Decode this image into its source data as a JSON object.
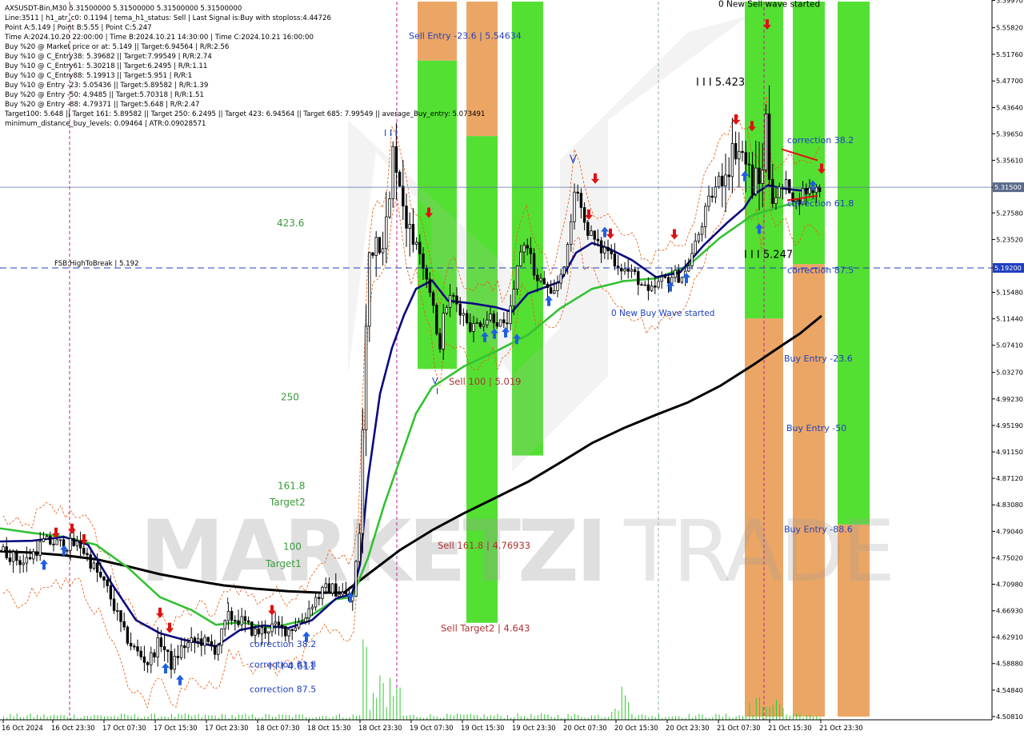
{
  "window": {
    "title_line": "AXSUSDT-Bin,M30  5.31500000 5.31500000 5.31500000 5.31500000"
  },
  "info_lines": [
    "Line:3511 | h1_atr_c0: 0.1194 | tema_h1_status: Sell | Last Signal is:Buy with stoploss:4.44726",
    "Point A:5.149 | Point B:5.55 | Point C:5.247",
    "Time A:2024.10.20 22:00:00 | Time B:2024.10.21 14:30:00 | Time C:2024.10.21 16:00:00",
    "Buy %20 @ Market price or at: 5.149 || Target:6.94564 | R/R:2.56",
    "Buy %10 @ C_Entry38: 5.39682 || Target:7.99549 | R/R:2.74",
    "Buy %10 @ C_Entry61: 5.30218 || Target:6.2495 | R/R:1.11",
    "Buy %10 @ C_Entry88: 5.19913 || Target:5.951 | R/R:1",
    "Buy %10 @ Entry -23: 5.05436 || Target:5.89582 | R/R:1.39",
    "Buy %20 @ Entry -50: 4.9485 || Target:5.70318 | R/R:1.51",
    "Buy %20 @ Entry -88: 4.79371 || Target:5.648 | R/R:2.47",
    "Target100: 5.648 || Target 161: 5.89582 || Target 250: 6.2495 || Target 423: 6.94564 || Target 685: 7.99549 || average_Buy_entry: 5.073491",
    "minimum_distance_buy_levels: 0.09464 | ATR:0.09028571"
  ],
  "watermark": {
    "left": "MARKETZI",
    "right": "TRADE"
  },
  "chart_data": {
    "type": "candlestick",
    "symbol": "AXSUSDT-Bin",
    "timeframe": "M30",
    "ylim": [
      4.508,
      5.598
    ],
    "current_price": 5.315,
    "y_ticks": [
      "5.59970",
      "5.55820",
      "5.51760",
      "5.47700",
      "5.43640",
      "5.39650",
      "5.35610",
      "5.31500",
      "5.27580",
      "5.23520",
      "5.19200",
      "5.15480",
      "5.11440",
      "5.07410",
      "5.03270",
      "4.99230",
      "4.95190",
      "4.91150",
      "4.87120",
      "4.83080",
      "4.79040",
      "4.75020",
      "4.70980",
      "4.66930",
      "4.62910",
      "4.58880",
      "4.54840",
      "4.50810"
    ],
    "x_ticks": [
      "16 Oct 2024",
      "16 Oct 23:30",
      "17 Oct 07:30",
      "17 Oct 15:30",
      "17 Oct 23:30",
      "18 Oct 07:30",
      "18 Oct 15:30",
      "18 Oct 23:30",
      "19 Oct 07:30",
      "19 Oct 15:30",
      "19 Oct 23:30",
      "20 Oct 07:30",
      "20 Oct 15:30",
      "20 Oct 23:30",
      "21 Oct 07:30",
      "21 Oct 15:30",
      "21 Oct 23:30"
    ],
    "colors": {
      "bull": "#000000",
      "bear": "#000000",
      "ma_fast": "#0a0a80",
      "ma_mid": "#33c233",
      "ma_slow": "#000000",
      "band_green": "#44dd22",
      "band_orange": "#e8964a",
      "price_line": "#1f3fbf",
      "fsb_line": "#1f3fbf",
      "sell_arrow": "#e01010",
      "buy_arrow": "#1f5fe0",
      "volume": "#33cc33",
      "envelope": "#e85a10"
    },
    "price_levels": [
      {
        "label": "FSB:HighToBreak | 5.192",
        "price": 5.192
      }
    ],
    "left_levels": [
      {
        "label": "423.6",
        "price": 5.26,
        "color": "green"
      },
      {
        "label": "250",
        "price": 4.995,
        "color": "green"
      },
      {
        "label": "161.8",
        "price": 4.86,
        "color": "green"
      },
      {
        "label": "Target2",
        "price": 4.835,
        "color": "green"
      },
      {
        "label": "100",
        "price": 4.767,
        "color": "green"
      },
      {
        "label": "Target1",
        "price": 4.741,
        "color": "green"
      }
    ],
    "band_labels": [
      {
        "label": "Sell Entry -23.6 | 5.54634",
        "price": 5.546,
        "color": "blue"
      },
      {
        "label": "Sell 100 | 5.019",
        "price": 5.019,
        "color": "red"
      },
      {
        "label": "Sell 161.8 | 4.76933",
        "price": 4.769,
        "color": "red"
      },
      {
        "label": "Sell Target2 | 4.643",
        "price": 4.643,
        "color": "red"
      },
      {
        "label": "correction 38.2",
        "price": 5.387,
        "color": "blue"
      },
      {
        "label": "correction 61.8",
        "price": 5.291,
        "color": "blue"
      },
      {
        "label": "correction 87.5",
        "price": 5.189,
        "color": "blue"
      },
      {
        "label": "Buy Entry -23.6",
        "price": 5.054,
        "color": "blue"
      },
      {
        "label": "Buy Entry -50",
        "price": 4.948,
        "color": "blue"
      },
      {
        "label": "Buy Entry -88.6",
        "price": 4.794,
        "color": "blue"
      },
      {
        "label": "correction 38.2",
        "price": 4.619,
        "color": "blue"
      },
      {
        "label": "correction 61.8",
        "price": 4.588,
        "color": "blue"
      },
      {
        "label": "correction 87.5",
        "price": 4.55,
        "color": "blue"
      }
    ],
    "wave_labels": [
      {
        "label": "0 New Sell wave started",
        "price": 5.595
      },
      {
        "label": "0 New Buy Wave started",
        "price": 5.124
      },
      {
        "label": "I I I 5.423",
        "price": 5.475
      },
      {
        "label": "I I I 5.247",
        "price": 5.212
      },
      {
        "label": "I I I",
        "price": 5.398
      },
      {
        "label": "V",
        "price": 5.357
      },
      {
        "label": "V",
        "price": 5.02
      },
      {
        "label": "I",
        "price": 5.004
      },
      {
        "label": "I I I 4.611",
        "price": 4.585
      },
      {
        "label": "I",
        "price": 4.685
      }
    ],
    "ma_slow_points": [
      [
        0,
        4.76
      ],
      [
        40,
        4.758
      ],
      [
        80,
        4.754
      ],
      [
        120,
        4.748
      ],
      [
        160,
        4.737
      ],
      [
        200,
        4.725
      ],
      [
        240,
        4.716
      ],
      [
        280,
        4.708
      ],
      [
        320,
        4.703
      ],
      [
        360,
        4.699
      ],
      [
        400,
        4.697
      ],
      [
        430,
        4.697
      ],
      [
        460,
        4.725
      ],
      [
        500,
        4.762
      ],
      [
        540,
        4.792
      ],
      [
        580,
        4.818
      ],
      [
        620,
        4.842
      ],
      [
        660,
        4.866
      ],
      [
        700,
        4.895
      ],
      [
        740,
        4.925
      ],
      [
        780,
        4.948
      ],
      [
        820,
        4.968
      ],
      [
        860,
        4.987
      ],
      [
        900,
        5.012
      ],
      [
        940,
        5.043
      ],
      [
        980,
        5.076
      ],
      [
        1000,
        5.092
      ],
      [
        1027,
        5.119
      ]
    ],
    "ma_mid_points": [
      [
        0,
        4.795
      ],
      [
        40,
        4.788
      ],
      [
        80,
        4.782
      ],
      [
        120,
        4.77
      ],
      [
        160,
        4.735
      ],
      [
        200,
        4.69
      ],
      [
        240,
        4.67
      ],
      [
        270,
        4.648
      ],
      [
        300,
        4.652
      ],
      [
        340,
        4.643
      ],
      [
        380,
        4.655
      ],
      [
        420,
        4.687
      ],
      [
        440,
        4.69
      ],
      [
        460,
        4.75
      ],
      [
        480,
        4.83
      ],
      [
        500,
        4.9
      ],
      [
        520,
        4.97
      ],
      [
        540,
        5.01
      ],
      [
        580,
        5.042
      ],
      [
        620,
        5.065
      ],
      [
        660,
        5.09
      ],
      [
        700,
        5.13
      ],
      [
        740,
        5.16
      ],
      [
        780,
        5.172
      ],
      [
        820,
        5.176
      ],
      [
        860,
        5.195
      ],
      [
        900,
        5.238
      ],
      [
        940,
        5.272
      ],
      [
        980,
        5.287
      ],
      [
        1020,
        5.298
      ]
    ],
    "ma_fast_points": [
      [
        0,
        4.775
      ],
      [
        40,
        4.776
      ],
      [
        80,
        4.782
      ],
      [
        110,
        4.77
      ],
      [
        140,
        4.71
      ],
      [
        170,
        4.655
      ],
      [
        200,
        4.635
      ],
      [
        230,
        4.625
      ],
      [
        270,
        4.615
      ],
      [
        300,
        4.64
      ],
      [
        330,
        4.647
      ],
      [
        360,
        4.643
      ],
      [
        390,
        4.655
      ],
      [
        420,
        4.688
      ],
      [
        440,
        4.695
      ],
      [
        450,
        4.74
      ],
      [
        460,
        4.87
      ],
      [
        475,
        5.0
      ],
      [
        490,
        5.07
      ],
      [
        505,
        5.12
      ],
      [
        520,
        5.16
      ],
      [
        540,
        5.173
      ],
      [
        560,
        5.142
      ],
      [
        590,
        5.138
      ],
      [
        620,
        5.132
      ],
      [
        640,
        5.125
      ],
      [
        660,
        5.153
      ],
      [
        680,
        5.162
      ],
      [
        700,
        5.171
      ],
      [
        720,
        5.215
      ],
      [
        740,
        5.23
      ],
      [
        760,
        5.222
      ],
      [
        790,
        5.204
      ],
      [
        820,
        5.178
      ],
      [
        850,
        5.185
      ],
      [
        880,
        5.227
      ],
      [
        910,
        5.262
      ],
      [
        930,
        5.283
      ],
      [
        940,
        5.302
      ],
      [
        960,
        5.318
      ],
      [
        980,
        5.313
      ],
      [
        1000,
        5.31
      ],
      [
        1025,
        5.315
      ]
    ],
    "bands": [
      {
        "x": [
          522,
          571
        ],
        "green_from": 5.508,
        "green_to": 5.038,
        "orange_from": 5.598,
        "orange_to": 5.508
      },
      {
        "x": [
          583,
          622
        ],
        "green_from": 5.393,
        "green_to": 4.651,
        "orange_from": 5.598,
        "orange_to": 5.393
      },
      {
        "x": [
          640,
          679
        ],
        "green_from": 5.598,
        "green_to": 4.906,
        "orange_from": null,
        "orange_to": null
      },
      {
        "x": [
          931,
          979
        ],
        "green_from": 5.598,
        "green_to": 5.115,
        "orange_from": 5.115,
        "orange_to": 4.508
      },
      {
        "x": [
          991,
          1031
        ],
        "green_from": 5.598,
        "green_to": 5.198,
        "orange_from": 5.198,
        "orange_to": 4.508
      },
      {
        "x": [
          1047,
          1087
        ],
        "green_from": 5.598,
        "green_to": 4.801,
        "orange_from": 4.801,
        "orange_to": 4.508
      }
    ],
    "candle_count": 244
  }
}
